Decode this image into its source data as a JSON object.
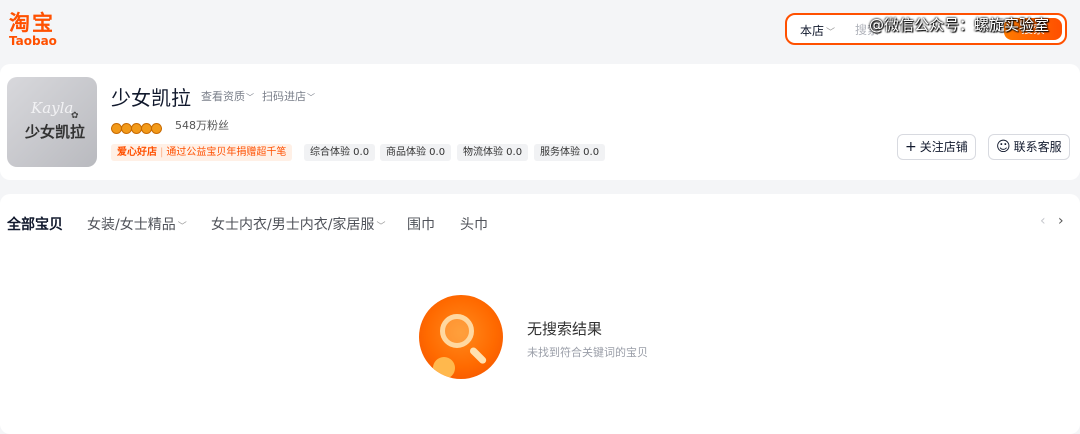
{
  "header": {
    "logo_cn": "淘宝",
    "logo_en": "Taobao",
    "search": {
      "scope": "本店",
      "placeholder": "搜索",
      "button": "搜索"
    },
    "watermark": "@微信公众号：螺旋实验室"
  },
  "shop": {
    "name": "少女凯拉",
    "logo_script": "Kayla",
    "logo_text": "少女凯拉",
    "view_profile": "查看资质",
    "scan_enter": "扫码进店",
    "fans": "548万粉丝",
    "rating_icon_count": 5,
    "charity_badge": "爱心好店",
    "charity_text": "通过公益宝贝年捐赠超千笔",
    "scores": [
      {
        "label": "综合体验 0.0"
      },
      {
        "label": "商品体验 0.0"
      },
      {
        "label": "物流体验 0.0"
      },
      {
        "label": "服务体验 0.0"
      }
    ],
    "follow_button": "关注店铺",
    "service_button": "联系客服"
  },
  "categories": [
    {
      "label": "全部宝贝"
    },
    {
      "label": "女装/女士精品"
    },
    {
      "label": "女士内衣/男士内衣/家居服"
    },
    {
      "label": "围巾"
    },
    {
      "label": "头巾"
    }
  ],
  "empty_state": {
    "title": "无搜索结果",
    "subtitle": "未找到符合关键词的宝贝"
  },
  "colors": {
    "brand": "#ff5000",
    "background": "#f4f5f7"
  }
}
